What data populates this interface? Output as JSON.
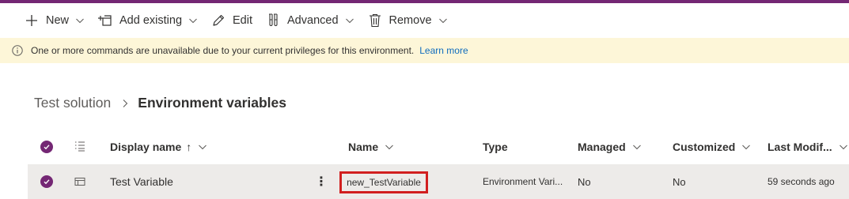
{
  "colors": {
    "accent": "#742774",
    "message_bg": "#fdf6d8",
    "link": "#0f6cbd",
    "highlight": "#d11f1f",
    "selected_row": "#edebe9"
  },
  "toolbar": {
    "new_label": "New",
    "add_existing_label": "Add existing",
    "edit_label": "Edit",
    "advanced_label": "Advanced",
    "remove_label": "Remove"
  },
  "message": {
    "text": "One or more commands are unavailable due to your current privileges for this environment.",
    "link": "Learn more"
  },
  "breadcrumb": {
    "parent": "Test solution",
    "current": "Environment variables"
  },
  "grid": {
    "columns": {
      "display_name": "Display name",
      "sort_arrow": "↑",
      "name": "Name",
      "type": "Type",
      "managed": "Managed",
      "customized": "Customized",
      "last_modified": "Last Modif..."
    },
    "rows": [
      {
        "display_name": "Test Variable",
        "more": "⋮",
        "name": "new_TestVariable",
        "type": "Environment Vari...",
        "managed": "No",
        "customized": "No",
        "last_modified": "59 seconds ago"
      }
    ]
  },
  "icons": [
    "plus-icon",
    "add-existing-icon",
    "pencil-icon",
    "flask-icon",
    "trash-icon",
    "info-icon",
    "chevron-down-icon",
    "chevron-right-icon",
    "checkmark-icon",
    "list-icon",
    "table-icon"
  ]
}
